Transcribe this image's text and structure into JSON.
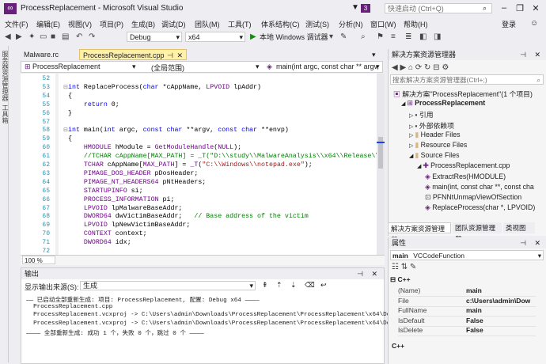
{
  "window": {
    "title": "ProcessReplacement - Microsoft Visual Studio",
    "notification_count": "3",
    "quick_launch_placeholder": "快速启动 (Ctrl+Q)",
    "signin": "登录"
  },
  "menu": [
    "文件(F)",
    "编辑(E)",
    "视图(V)",
    "项目(P)",
    "生成(B)",
    "调试(D)",
    "团队(M)",
    "工具(T)",
    "体系结构(C)",
    "测试(S)",
    "分析(N)",
    "窗口(W)",
    "帮助(H)"
  ],
  "toolbar": {
    "config": "Debug",
    "platform": "x64",
    "run_label": "本地 Windows 调试器"
  },
  "left_strip": [
    "服务器资源管理器",
    "工具箱"
  ],
  "doc_tabs": [
    {
      "label": "Malware.rc",
      "active": false
    },
    {
      "label": "ProcessReplacement.cpp",
      "active": true
    }
  ],
  "navbar": {
    "project": "ProcessReplacement",
    "scope": "(全局范围)",
    "function": "main(int argc, const char ** argv,"
  },
  "editor": {
    "zoom": "100 %",
    "lines": [
      {
        "n": "52",
        "html": ""
      },
      {
        "n": "53",
        "html": "<span class='kw'>int</span> ReplaceProcess(<span class='kw'>char</span> *cAppName, <span class='ty'>LPVOID</span> lpAddr)"
      },
      {
        "n": "54",
        "html": "{"
      },
      {
        "n": "55",
        "html": "    <span class='kw'>return</span> 0;"
      },
      {
        "n": "56",
        "html": "}"
      },
      {
        "n": "57",
        "html": ""
      },
      {
        "n": "58",
        "html": "<span class='kw'>int</span> main(<span class='kw'>int</span> argc, <span class='kw'>const char</span> **argv, <span class='kw'>const char</span> **envp)"
      },
      {
        "n": "59",
        "html": "{"
      },
      {
        "n": "60",
        "html": "    <span class='ty'>HMODULE</span> hModule = <span class='mac'>GetModuleHandle</span>(<span class='mac'>NULL</span>);"
      },
      {
        "n": "61",
        "html": "    <span class='cm'>//TCHAR cAppName[MAX_PATH] = _T(\"D:\\\\study\\\\MalwareAnalysis\\\\x64\\\\Release\\\\Mes:</span>"
      },
      {
        "n": "62",
        "html": "    <span class='ty'>TCHAR</span> cAppName[<span class='mac'>MAX_PATH</span>] = <span class='mac'>_T</span>(<span class='str'>\"C:\\\\Windows\\\\notepad.exe\"</span>);"
      },
      {
        "n": "63",
        "html": "    <span class='ty'>PIMAGE_DOS_HEADER</span> pDosHeader;"
      },
      {
        "n": "64",
        "html": "    <span class='ty'>PIMAGE_NT_HEADERS64</span> pNtHeaders;"
      },
      {
        "n": "65",
        "html": "    <span class='ty'>STARTUPINFO</span> si;"
      },
      {
        "n": "66",
        "html": "    <span class='ty'>PROCESS_INFORMATION</span> pi;"
      },
      {
        "n": "67",
        "html": "    <span class='ty'>LPVOID</span> lpMalwareBaseAddr;"
      },
      {
        "n": "68",
        "html": "    <span class='ty'>DWORD64</span> dwVictimBaseAddr;   <span class='cm'>// Base address of the victim</span>"
      },
      {
        "n": "69",
        "html": "    <span class='ty'>LPVOID</span> lpNewVictimBaseAddr;"
      },
      {
        "n": "70",
        "html": "    <span class='ty'>CONTEXT</span> context;"
      },
      {
        "n": "71",
        "html": "    <span class='ty'>DWORD64</span> idx;"
      },
      {
        "n": "72",
        "html": ""
      }
    ]
  },
  "output": {
    "title": "输出",
    "source_label": "显示输出来源(S):",
    "source_value": "生成",
    "lines": [
      "—— 已启动全部重新生成: 项目: ProcessReplacement, 配置: Debug x64 ————",
      "  ProcessReplacement.cpp",
      "  ProcessReplacement.vcxproj -> C:\\Users\\admin\\Downloads\\ProcessReplacement\\ProcessReplacement\\x64\\Debug\\Proc",
      "  ProcessReplacement.vcxproj -> C:\\Users\\admin\\Downloads\\ProcessReplacement\\ProcessReplacement\\x64\\Debug\\Proc",
      "———— 全部重新生成: 成功 1 个，失败 0 个，跳过 0 个 ————"
    ]
  },
  "solution_explorer": {
    "title": "解决方案资源管理器",
    "search_placeholder": "搜索解决方案资源管理器(Ctrl+;)",
    "tree": [
      {
        "label": "解决方案\"ProcessReplacement\"(1 个项目)",
        "indent": 0,
        "icon": "solution-icon",
        "bold": false
      },
      {
        "label": "ProcessReplacement",
        "indent": 1,
        "icon": "project-icon",
        "bold": true
      },
      {
        "label": "引用",
        "indent": 2,
        "icon": "references-icon",
        "bold": false
      },
      {
        "label": "外部依赖项",
        "indent": 2,
        "icon": "external-deps-icon",
        "bold": false
      },
      {
        "label": "Header Files",
        "indent": 2,
        "icon": "folder-icon",
        "bold": false
      },
      {
        "label": "Resource Files",
        "indent": 2,
        "icon": "folder-icon",
        "bold": false
      },
      {
        "label": "Source Files",
        "indent": 2,
        "icon": "folder-icon",
        "bold": false
      },
      {
        "label": "ProcessReplacement.cpp",
        "indent": 3,
        "icon": "cpp-file-icon",
        "bold": false
      },
      {
        "label": "ExtractRes(HMODULE)",
        "indent": 4,
        "icon": "method-icon",
        "bold": false
      },
      {
        "label": "main(int, const char **, const cha",
        "indent": 4,
        "icon": "method-icon",
        "bold": false
      },
      {
        "label": "PFNNtUnmapViewOfSection",
        "indent": 4,
        "icon": "typedef-icon",
        "bold": false
      },
      {
        "label": "ReplaceProcess(char *, LPVOID)",
        "indent": 4,
        "icon": "method-icon",
        "bold": false
      }
    ],
    "tabs": [
      "解决方案资源管理器",
      "团队资源管理器",
      "类视图"
    ]
  },
  "properties": {
    "title": "属性",
    "object_name": "main",
    "object_type": "VCCodeFunction",
    "category": "C++",
    "rows": [
      {
        "k": "(Name)",
        "v": "main"
      },
      {
        "k": "File",
        "v": "c:\\Users\\admin\\Dow"
      },
      {
        "k": "FullName",
        "v": "main"
      },
      {
        "k": "IsDefault",
        "v": "False"
      },
      {
        "k": "IsDelete",
        "v": "False"
      }
    ],
    "footer": "C++"
  }
}
